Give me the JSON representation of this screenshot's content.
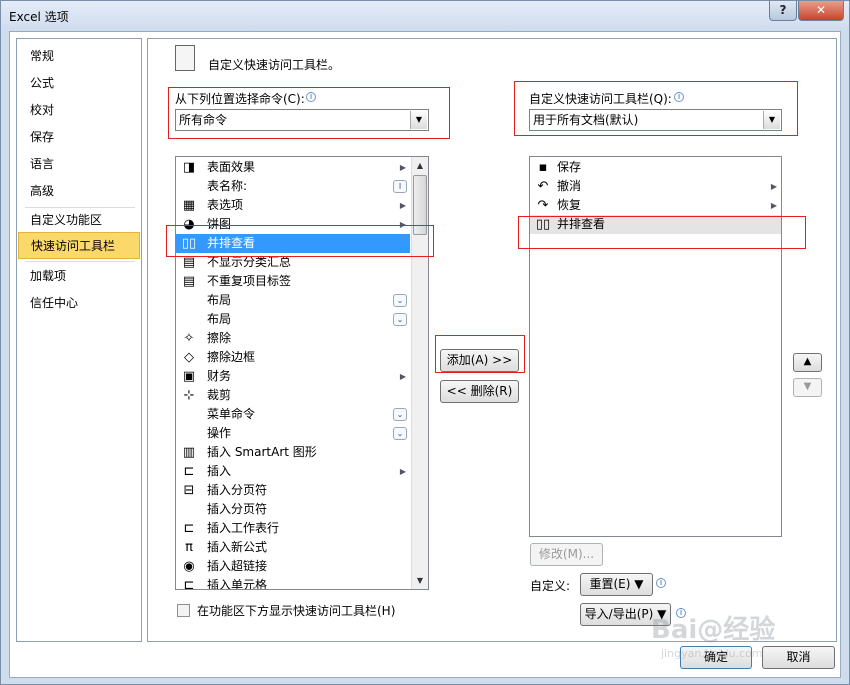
{
  "window": {
    "title": "Excel 选项",
    "help": "?",
    "close": "✕"
  },
  "nav": [
    {
      "label": "常规",
      "selected": false
    },
    {
      "label": "公式",
      "selected": false
    },
    {
      "label": "校对",
      "selected": false
    },
    {
      "label": "保存",
      "selected": false
    },
    {
      "label": "语言",
      "selected": false
    },
    {
      "label": "高级",
      "selected": false
    },
    {
      "label": "自定义功能区",
      "selected": false
    },
    {
      "label": "快速访问工具栏",
      "selected": true
    },
    {
      "label": "加载项",
      "selected": false
    },
    {
      "label": "信任中心",
      "selected": false
    }
  ],
  "header": {
    "title": "自定义快速访问工具栏。"
  },
  "left": {
    "label": "从下列位置选择命令(C):",
    "combo_value": "所有命令",
    "items": [
      {
        "label": "表面效果",
        "icon": "◨",
        "suffix": "sub"
      },
      {
        "label": "表名称:",
        "icon": "",
        "suffix": "cursor"
      },
      {
        "label": "表选项",
        "icon": "▦",
        "suffix": "sub"
      },
      {
        "label": "饼图",
        "icon": "◕",
        "suffix": "sub"
      },
      {
        "label": "并排查看",
        "icon": "▯▯",
        "suffix": "",
        "selected": true
      },
      {
        "label": "不显示分类汇总",
        "icon": "▤",
        "suffix": ""
      },
      {
        "label": "不重复项目标签",
        "icon": "▤",
        "suffix": ""
      },
      {
        "label": "布局",
        "icon": "",
        "suffix": "drop"
      },
      {
        "label": "布局",
        "icon": "",
        "suffix": "drop"
      },
      {
        "label": "擦除",
        "icon": "✧",
        "suffix": ""
      },
      {
        "label": "擦除边框",
        "icon": "◇",
        "suffix": ""
      },
      {
        "label": "财务",
        "icon": "▣",
        "suffix": "sub"
      },
      {
        "label": "裁剪",
        "icon": "⊹",
        "suffix": ""
      },
      {
        "label": "菜单命令",
        "icon": "",
        "suffix": "drop"
      },
      {
        "label": "操作",
        "icon": "",
        "suffix": "drop"
      },
      {
        "label": "插入 SmartArt 图形",
        "icon": "▥",
        "suffix": ""
      },
      {
        "label": "插入",
        "icon": "⊏",
        "suffix": "sub"
      },
      {
        "label": "插入分页符",
        "icon": "⊟",
        "suffix": ""
      },
      {
        "label": "插入分页符",
        "icon": "",
        "suffix": ""
      },
      {
        "label": "插入工作表行",
        "icon": "⊏",
        "suffix": ""
      },
      {
        "label": "插入新公式",
        "icon": "π",
        "suffix": ""
      },
      {
        "label": "插入超链接",
        "icon": "◉",
        "suffix": ""
      },
      {
        "label": "插入单元格",
        "icon": "⊏",
        "suffix": ""
      }
    ],
    "checkbox_label": "在功能区下方显示快速访问工具栏(H)"
  },
  "right": {
    "label": "自定义快速访问工具栏(Q):",
    "combo_value": "用于所有文档(默认)",
    "items": [
      {
        "label": "保存",
        "icon": "▪",
        "suffix": ""
      },
      {
        "label": "撤消",
        "icon": "↶",
        "suffix": "sub"
      },
      {
        "label": "恢复",
        "icon": "↷",
        "suffix": "sub"
      },
      {
        "label": "并排查看",
        "icon": "▯▯",
        "suffix": "",
        "highlight": true
      }
    ],
    "modify_label": "修改(M)...",
    "customize_label": "自定义:",
    "reset_label": "重置(E) ▼",
    "import_export_label": "导入/导出(P) ▼"
  },
  "buttons": {
    "add": "添加(A) >>",
    "remove": "<< 删除(R)",
    "ok": "确定",
    "cancel": "取消",
    "move_up": "▲",
    "move_down": "▼"
  },
  "watermark": {
    "text": "Bai@经验",
    "subtext": "jingyan.baidu.com"
  }
}
